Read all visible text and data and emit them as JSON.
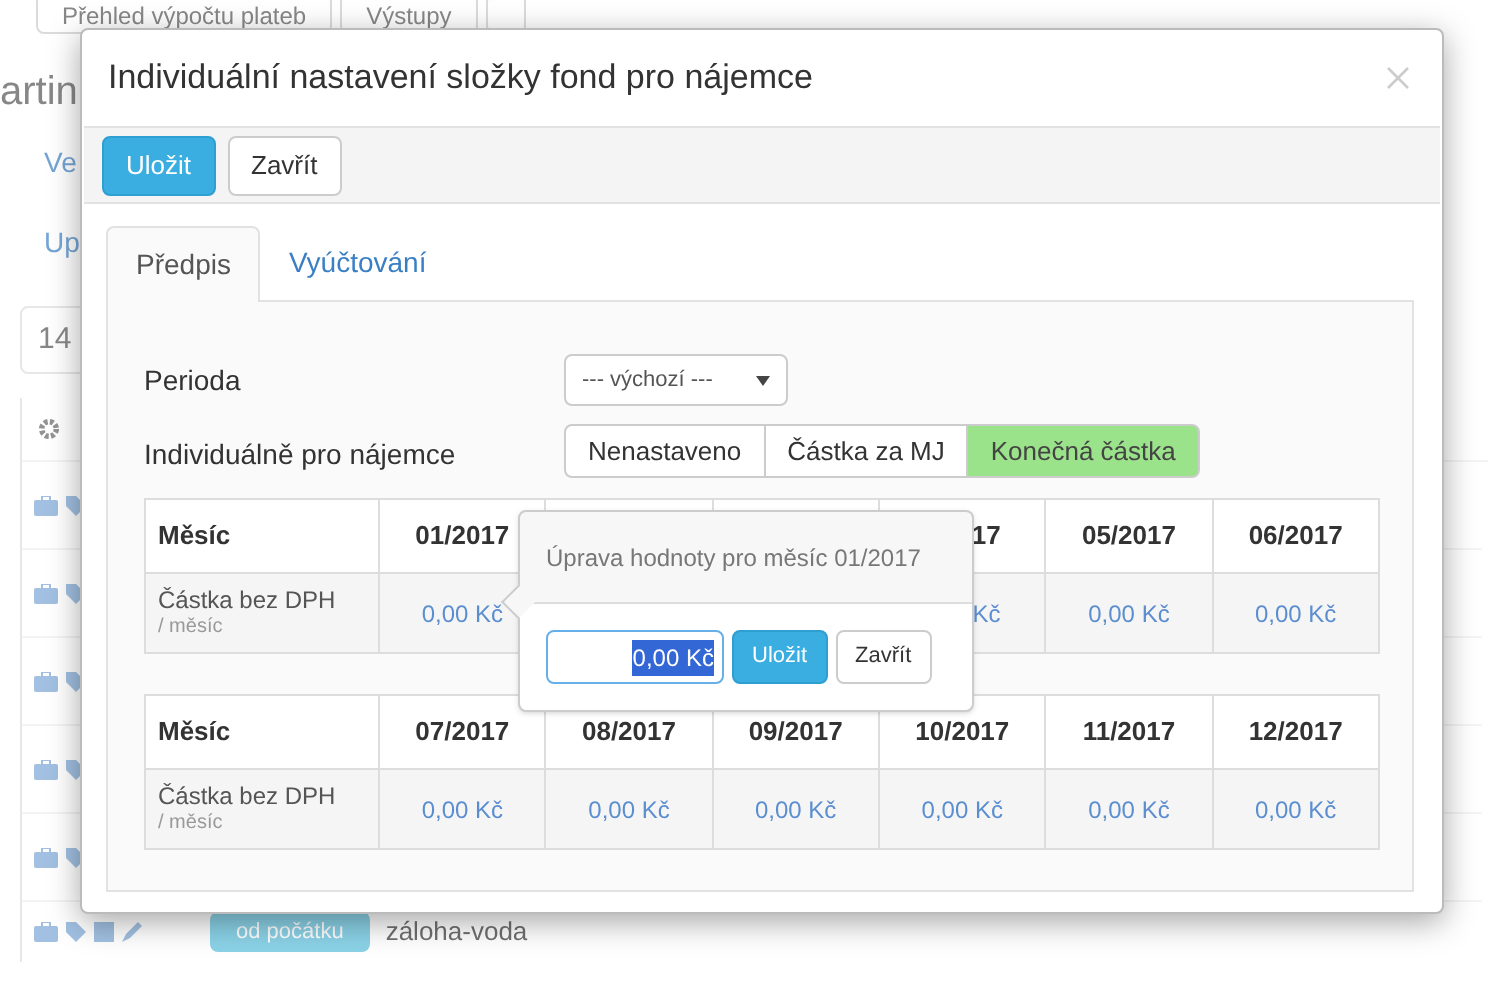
{
  "background": {
    "toolbar_buttons": [
      "Přehled výpočtu plateb",
      "Výstupy"
    ],
    "heading": "artin",
    "tab": "Ve",
    "subtab": "Up",
    "filter_value": "14",
    "row": {
      "badge": "od počátku",
      "name": "záloha-voda"
    }
  },
  "modal": {
    "title": "Individuální nastavení složky fond pro nájemce",
    "buttons": [
      {
        "label": "Uložit",
        "kind": "primary"
      },
      {
        "label": "Zavřít",
        "kind": "default"
      }
    ],
    "tabs": [
      {
        "label": "Předpis",
        "selected": true
      },
      {
        "label": "Vyúčtování",
        "selected": false
      }
    ],
    "period": {
      "label": "Perioda",
      "value": "--- výchozí ---"
    },
    "individual": {
      "label": "Individuálně pro nájemce",
      "options": [
        {
          "label": "Nenastaveno",
          "selected": false
        },
        {
          "label": "Částka za MJ",
          "selected": false
        },
        {
          "label": "Konečná částka",
          "selected": true
        }
      ]
    },
    "tables": [
      {
        "header_label": "Měsíc",
        "row_label": "Částka bez DPH",
        "row_sublabel": "/ měsíc",
        "columns": [
          {
            "month": "01/2017",
            "value": "0,00 Kč"
          },
          {},
          {},
          {
            "month": "17",
            "value": "Kč",
            "partial": true
          },
          {
            "month": "05/2017",
            "value": "0,00 Kč"
          },
          {
            "month": "06/2017",
            "value": "0,00 Kč"
          }
        ]
      },
      {
        "header_label": "Měsíc",
        "row_label": "Částka bez DPH",
        "row_sublabel": "/ měsíc",
        "columns": [
          {
            "month": "07/2017",
            "value": "0,00 Kč"
          },
          {
            "month": "08/2017",
            "value": "0,00 Kč"
          },
          {
            "month": "09/2017",
            "value": "0,00 Kč"
          },
          {
            "month": "10/2017",
            "value": "0,00 Kč"
          },
          {
            "month": "11/2017",
            "value": "0,00 Kč"
          },
          {
            "month": "12/2017",
            "value": "0,00 Kč"
          }
        ]
      }
    ],
    "popover": {
      "title": "Úprava hodnoty pro měsíc 01/2017",
      "value": "0,00 Kč",
      "buttons": [
        {
          "label": "Uložit",
          "kind": "primary"
        },
        {
          "label": "Zavřít",
          "kind": "default"
        }
      ]
    }
  }
}
